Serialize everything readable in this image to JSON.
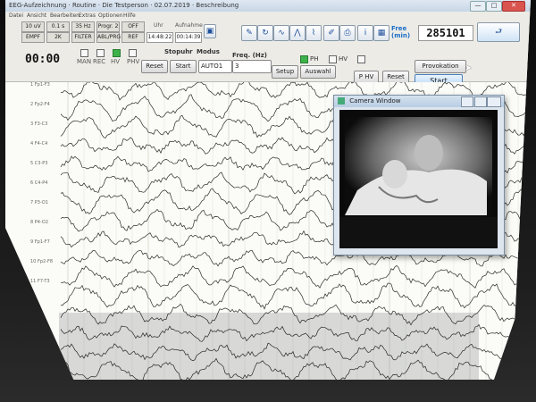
{
  "window": {
    "title": "EEG-Aufzeichnung · Routine · Die Testperson · 02.07.2019 · Beschreibung",
    "minimize": "—",
    "maximize": "□",
    "close": "✕"
  },
  "menu": [
    "Datei",
    "Ansicht",
    "Bearbeiten",
    "Extras",
    "Optionen",
    "Hilfe"
  ],
  "toolbar": {
    "row1": [
      "10 uV",
      "0.1 s",
      "35 Hz",
      "Progr. 2",
      "OFF"
    ],
    "row2": [
      "EMPF",
      "2K",
      "FILTER",
      "ABL/PRG",
      "REF"
    ],
    "uhr_label": "Uhr",
    "uhr_value": "14:48:22",
    "aufnahme_label": "Aufnahme",
    "aufnahme_value": "00:14:39",
    "free_label": "Free (min)",
    "free_value": "285101",
    "icons": [
      "edit-icon",
      "refresh-icon",
      "wave-icon",
      "chart-icon",
      "montage-icon",
      "pen-icon",
      "print-icon",
      "info-icon",
      "photo-icon"
    ]
  },
  "controls": {
    "timer": "00:00",
    "mode_buttons": [
      "MAN",
      "REC",
      "HV",
      "PHV",
      "P HV"
    ],
    "stop_label": "Stopuhr",
    "modus_label": "Modus",
    "freq_label": "Freq. (Hz)",
    "reset1": "Reset",
    "start1": "Start",
    "modus_value": "AUTO1",
    "freq_value": "3",
    "setup": "Setup",
    "auswahl": "Auswahl",
    "ph_label": "PH",
    "hv_label": "HV",
    "phv_button": "P HV",
    "reset2": "Reset",
    "provokation": "Provokation",
    "start2": "Start"
  },
  "channels": [
    "1 Fp1-F3",
    "2 Fp2-F4",
    "3 F3-C3",
    "4 F4-C4",
    "5 C3-P3",
    "6 C4-P4",
    "7 P3-O1",
    "8 P4-O2",
    "9 Fp1-F7",
    "10 Fp2-F8",
    "11 F7-T3"
  ],
  "camera": {
    "title": "Camera Window"
  },
  "colors": {
    "accent": "#1d6fc8",
    "ph_on": "#3db24a",
    "trace": "#2a2a2a"
  }
}
